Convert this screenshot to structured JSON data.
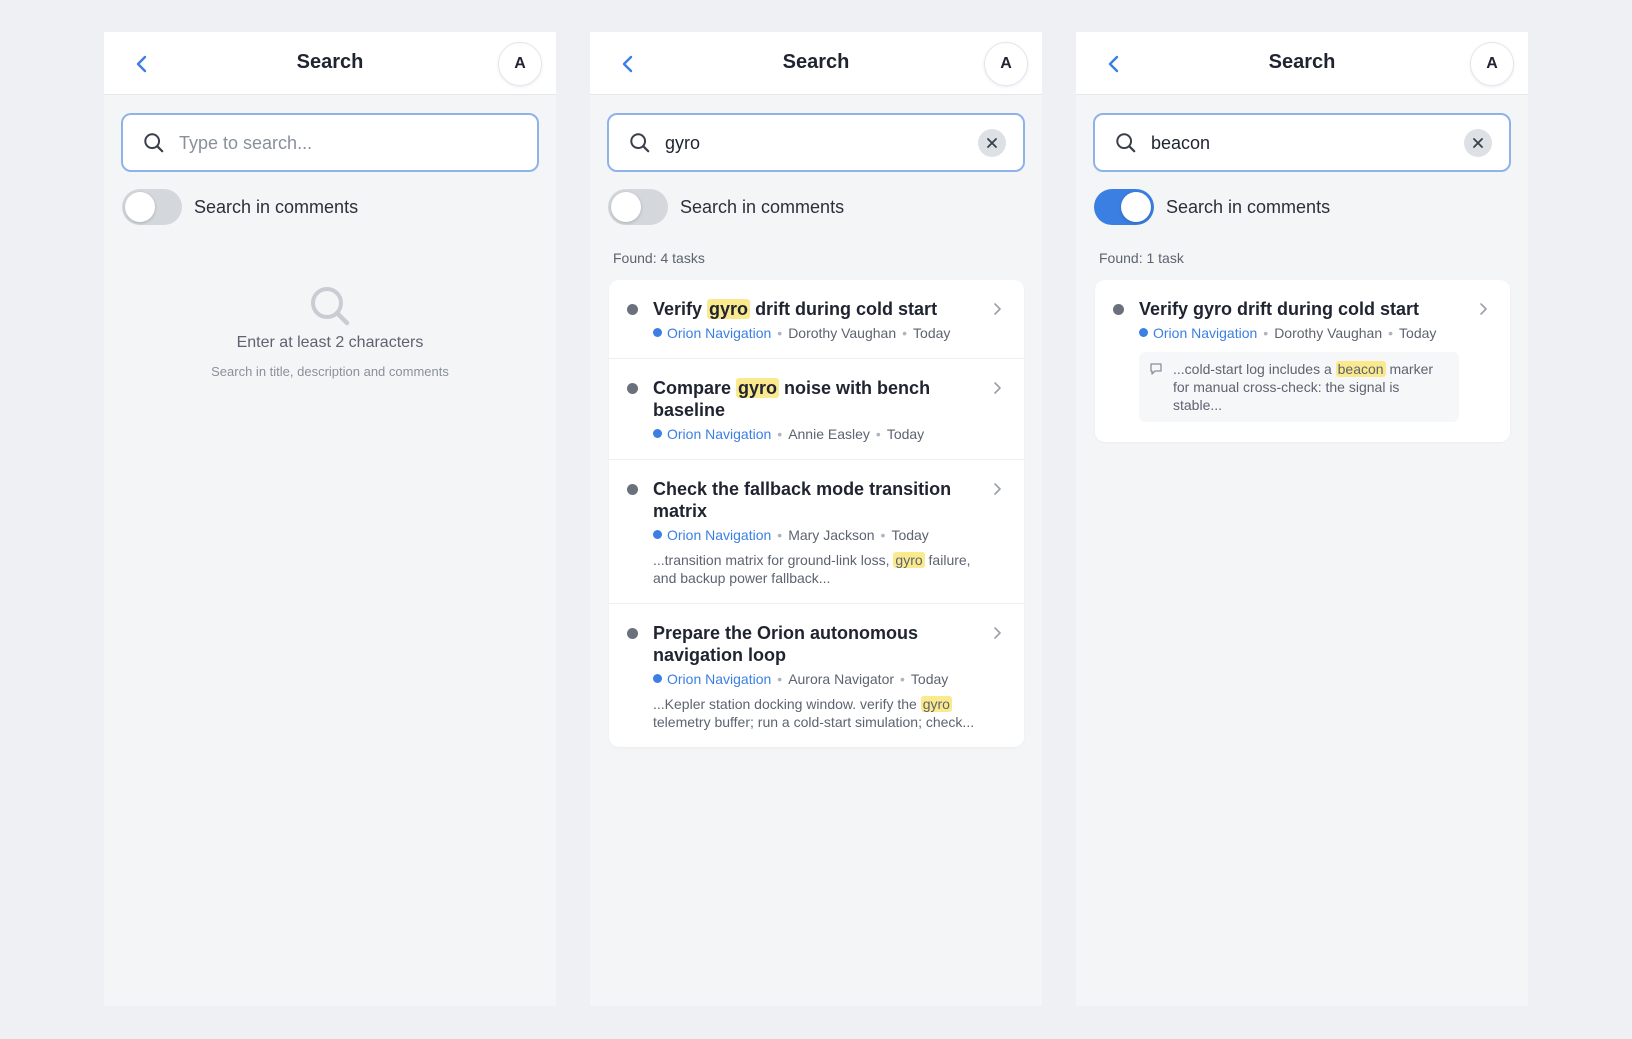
{
  "screens": [
    {
      "title": "Search",
      "avatar": "A",
      "search": {
        "value": "",
        "placeholder": "Type to search..."
      },
      "toggle": {
        "label": "Search in comments",
        "on": false
      },
      "empty": {
        "title": "Enter at least 2 characters",
        "subtitle": "Search in title, description and comments"
      }
    },
    {
      "title": "Search",
      "avatar": "A",
      "search": {
        "value": "gyro",
        "placeholder": "Type to search..."
      },
      "toggle": {
        "label": "Search in comments",
        "on": false
      },
      "found": "Found: 4 tasks",
      "results": [
        {
          "title_pre": "Verify ",
          "title_hl": "gyro",
          "title_post": " drift during cold start",
          "project": "Orion Navigation",
          "assignee": "Dorothy Vaughan",
          "date": "Today"
        },
        {
          "title_pre": "Compare ",
          "title_hl": "gyro",
          "title_post": " noise with bench baseline",
          "project": "Orion Navigation",
          "assignee": "Annie Easley",
          "date": "Today"
        },
        {
          "title_pre": "Check the fallback mode transition matrix",
          "title_hl": "",
          "title_post": "",
          "project": "Orion Navigation",
          "assignee": "Mary Jackson",
          "date": "Today",
          "snippet_pre": "...transition matrix for ground-link loss, ",
          "snippet_hl": "gyro",
          "snippet_post": " failure, and backup power fallback..."
        },
        {
          "title_pre": "Prepare the Orion autonomous navigation loop",
          "title_hl": "",
          "title_post": "",
          "project": "Orion Navigation",
          "assignee": "Aurora Navigator",
          "date": "Today",
          "snippet_pre": "...Kepler station docking window. verify the ",
          "snippet_hl": "gyro",
          "snippet_post": " telemetry buffer; run a cold-start simulation; check..."
        }
      ]
    },
    {
      "title": "Search",
      "avatar": "A",
      "search": {
        "value": "beacon",
        "placeholder": "Type to search..."
      },
      "toggle": {
        "label": "Search in comments",
        "on": true
      },
      "found": "Found: 1 task",
      "results": [
        {
          "title_pre": "Verify gyro drift during cold start",
          "title_hl": "",
          "title_post": "",
          "project": "Orion Navigation",
          "assignee": "Dorothy Vaughan",
          "date": "Today",
          "comment_pre": "...cold-start log includes a ",
          "comment_hl": "beacon",
          "comment_post": " marker for manual cross-check: the signal is stable..."
        }
      ]
    }
  ],
  "icons": {
    "back": "chevron-left-icon",
    "search": "search-icon",
    "clear": "close-icon",
    "chevron": "chevron-right-icon",
    "comment": "comment-icon"
  },
  "colors": {
    "accent": "#3b7fe3",
    "highlight": "#fbe98e",
    "search_border": "#8fb3e8",
    "toggle_off": "#d4d7dc"
  }
}
